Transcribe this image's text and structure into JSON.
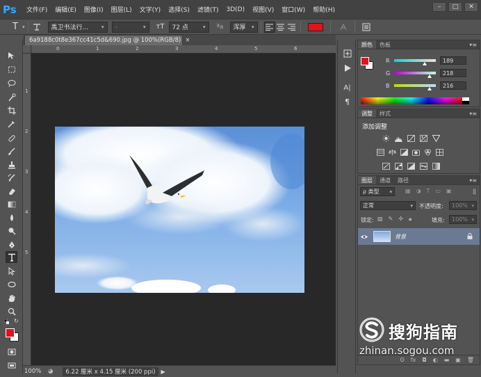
{
  "app": {
    "logo": "Ps"
  },
  "menu": [
    "文件(F)",
    "编辑(E)",
    "图像(I)",
    "图层(L)",
    "文字(Y)",
    "选择(S)",
    "滤镜(T)",
    "3D(D)",
    "视图(V)",
    "窗口(W)",
    "帮助(H)"
  ],
  "window_controls": {
    "minimize": "–",
    "restore": "□",
    "close": "✕"
  },
  "options": {
    "tool_icon": "T",
    "font_family": "禹卫书法行...",
    "font_style": "-",
    "size_icon": "тT",
    "font_size": "72 点",
    "aa_icon": "ªa",
    "antialias": "浑厚",
    "text_color": "#e2141b"
  },
  "document": {
    "tab_title": "6a9188c0t8e367cc41c5d&690.jpg @ 100%(RGB/8)",
    "tab_close": "×",
    "ruler_h_labels": [
      "0",
      "1",
      "2",
      "3",
      "4",
      "5",
      "6"
    ],
    "ruler_v_labels": [
      "1",
      "2",
      "3",
      "4",
      "5"
    ]
  },
  "status": {
    "zoom": "100%",
    "info": "6.22 厘米 x 4.15 厘米 (200 ppi)"
  },
  "color_panel": {
    "tabs": [
      "颜色",
      "色板"
    ],
    "fg": "#e2141b",
    "rows": [
      {
        "label": "R",
        "value": "189",
        "fraction": 0.74,
        "gradient": "linear-gradient(to right, #00d8d8, #ffd8d8)"
      },
      {
        "label": "G",
        "value": "218",
        "fraction": 0.85,
        "gradient": "linear-gradient(to right, #bd00d8, #bdffd8)"
      },
      {
        "label": "B",
        "value": "216",
        "fraction": 0.85,
        "gradient": "linear-gradient(to right, #bdda00, #bddaff)"
      }
    ]
  },
  "adjust_panel": {
    "tabs": [
      "调整",
      "样式"
    ],
    "title": "添加调整"
  },
  "layers_panel": {
    "tabs": [
      "图层",
      "通道",
      "路径"
    ],
    "kind_filter": "ρ 类型",
    "blend_mode": "正常",
    "opacity_label": "不透明度:",
    "opacity_value": "100%",
    "lock_label": "锁定:",
    "fill_label": "填充:",
    "fill_value": "100%",
    "layer": {
      "name": "背景",
      "visible": "●"
    },
    "footer_icons": [
      "ʘ",
      "fx",
      "◘",
      "◐",
      "▬",
      "▣",
      "🗑"
    ]
  },
  "watermark": {
    "brand": "搜狗指南",
    "url": "zhinan.sogou.com"
  }
}
